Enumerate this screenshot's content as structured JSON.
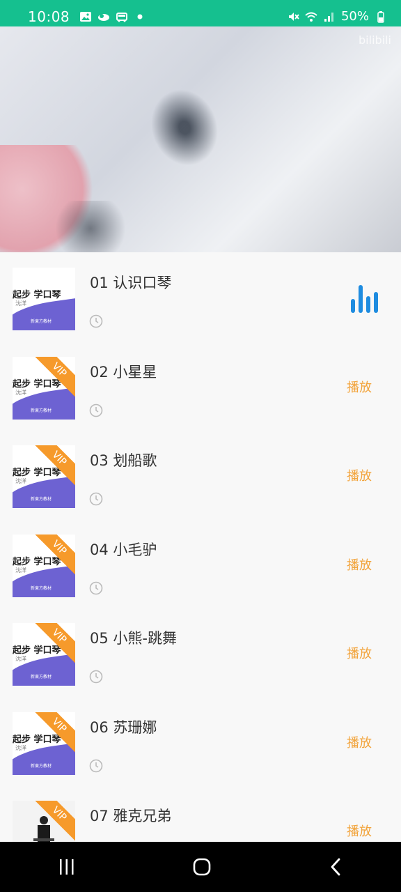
{
  "status_bar": {
    "time": "10:08",
    "battery": "50%",
    "icons_left": [
      "gallery-icon",
      "weather-icon",
      "car-icon",
      "dot-icon"
    ],
    "icons_right": [
      "mute-icon",
      "wifi-icon",
      "signal-icon",
      "battery-icon"
    ]
  },
  "video": {
    "watermark": "bilibili"
  },
  "thumbnail": {
    "title": "起步 学口琴",
    "subtitle": "沈洋",
    "footer": "新東方教材",
    "badge": "VIP"
  },
  "lessons": [
    {
      "title": "01 认识口琴",
      "vip": false,
      "action": "",
      "playing": true
    },
    {
      "title": "02 小星星",
      "vip": true,
      "action": "播放",
      "playing": false
    },
    {
      "title": "03 划船歌",
      "vip": true,
      "action": "播放",
      "playing": false
    },
    {
      "title": "04 小毛驴",
      "vip": true,
      "action": "播放",
      "playing": false
    },
    {
      "title": "05 小熊-跳舞",
      "vip": true,
      "action": "播放",
      "playing": false
    },
    {
      "title": "06 苏珊娜",
      "vip": true,
      "action": "播放",
      "playing": false
    },
    {
      "title": "07 雅克兄弟",
      "vip": true,
      "action": "播放",
      "playing": false
    }
  ],
  "colors": {
    "status_bar": "#15c08f",
    "accent_play": "#f2a33a",
    "vip_badge": "#f69a2b",
    "playing_indicator": "#1e8ce0"
  },
  "nav": {
    "buttons": [
      "recents-icon",
      "home-icon",
      "back-icon"
    ]
  }
}
